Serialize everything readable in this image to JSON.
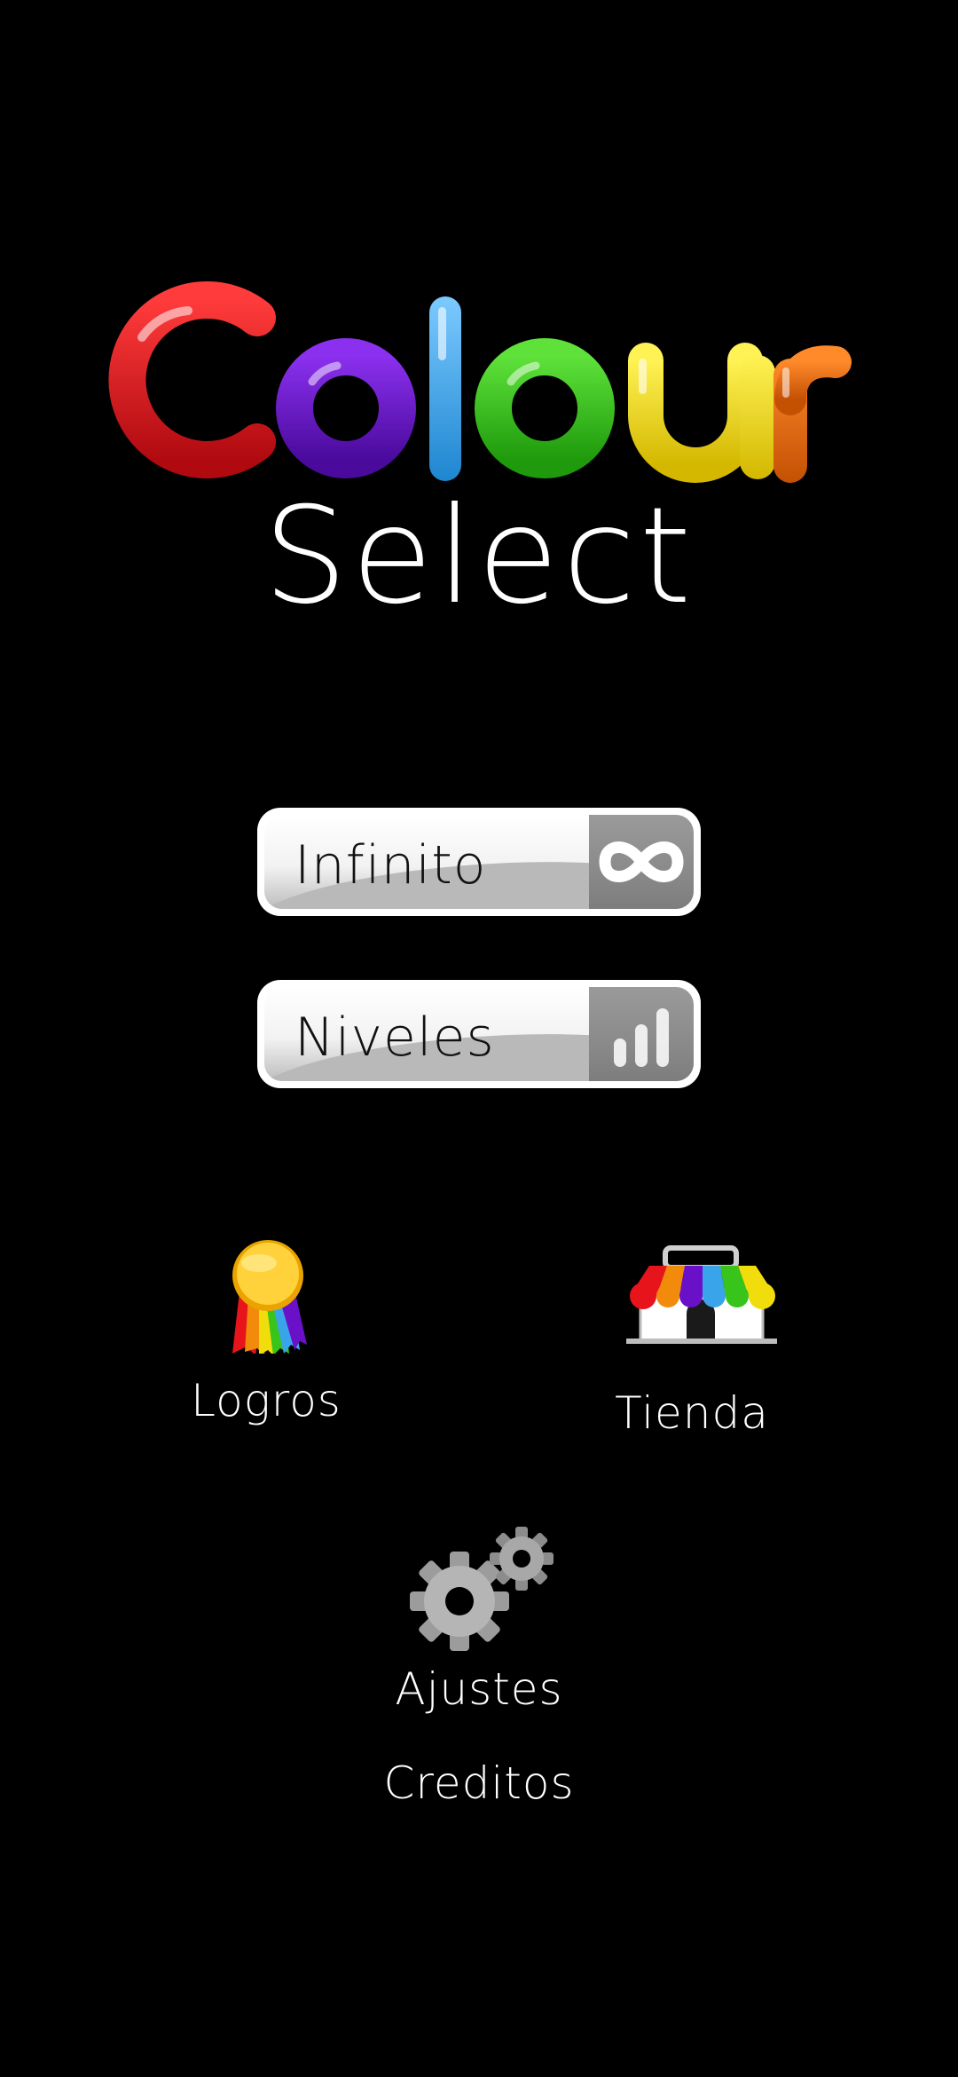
{
  "logo": {
    "letters": [
      {
        "char": "C",
        "color": "#e8141b"
      },
      {
        "char": "o",
        "color": "#6a10c8"
      },
      {
        "char": "l",
        "color": "#3aa4ea"
      },
      {
        "char": "o",
        "color": "#38c41a"
      },
      {
        "char": "u",
        "color": "#f2dd0c"
      },
      {
        "char": "r",
        "color": "#e8660d"
      }
    ],
    "subtitle": "Select"
  },
  "buttons": {
    "infinito": {
      "label": "Infinito",
      "icon": "infinity-icon"
    },
    "niveles": {
      "label": "Niveles",
      "icon": "bars-icon"
    }
  },
  "menu": {
    "logros": {
      "label": "Logros",
      "icon": "medal-icon"
    },
    "tienda": {
      "label": "Tienda",
      "icon": "shop-icon"
    },
    "ajustes": {
      "label": "Ajustes",
      "icon": "gears-icon"
    },
    "creditos": {
      "label": "Creditos"
    }
  },
  "colors": {
    "background": "#000000",
    "text": "#ffffff",
    "button_face": "#ffffff",
    "button_icon_box": "#8a8a8a"
  }
}
